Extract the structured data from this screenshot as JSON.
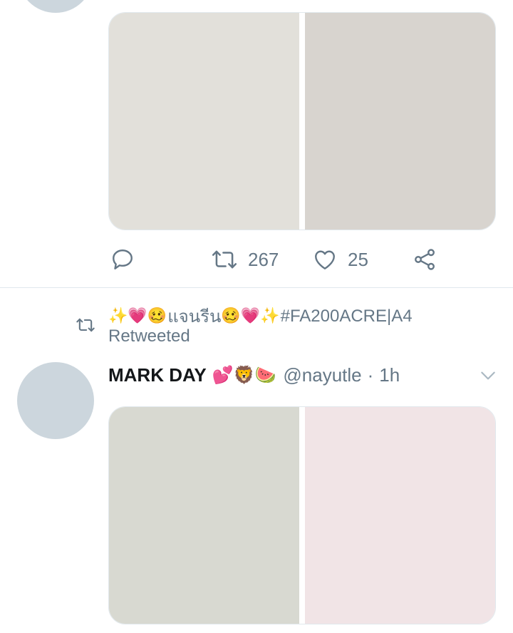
{
  "tweet_top": {
    "media_colors": [
      "#e2e0da",
      "#d8d4cf"
    ],
    "actions": {
      "reply": {
        "icon": "reply-icon",
        "count": ""
      },
      "retweet": {
        "icon": "retweet-icon",
        "count": "267"
      },
      "like": {
        "icon": "heart-icon",
        "count": "25"
      },
      "share": {
        "icon": "share-icon"
      }
    }
  },
  "retweet_banner": {
    "icon": "retweet-icon",
    "emoji_prefix": "✨💗🥴",
    "name_text": "แจนรีน",
    "emoji_suffix": "🥴💗✨",
    "hashtag": "#FA200ACRE|A4",
    "label": "Retweeted"
  },
  "tweet_second": {
    "display_name": "MARK DAY",
    "name_emojis": "💕🦁🍉",
    "handle": "@nayutle",
    "separator": "·",
    "time": "1h",
    "media_colors": [
      "#d8d9d1",
      "#f1e4e6"
    ],
    "menu_icon": "chevron-down-icon"
  },
  "colors": {
    "secondary_text": "#657786",
    "divider": "#e1e8ed",
    "avatar_placeholder": "#ccd6dd"
  }
}
